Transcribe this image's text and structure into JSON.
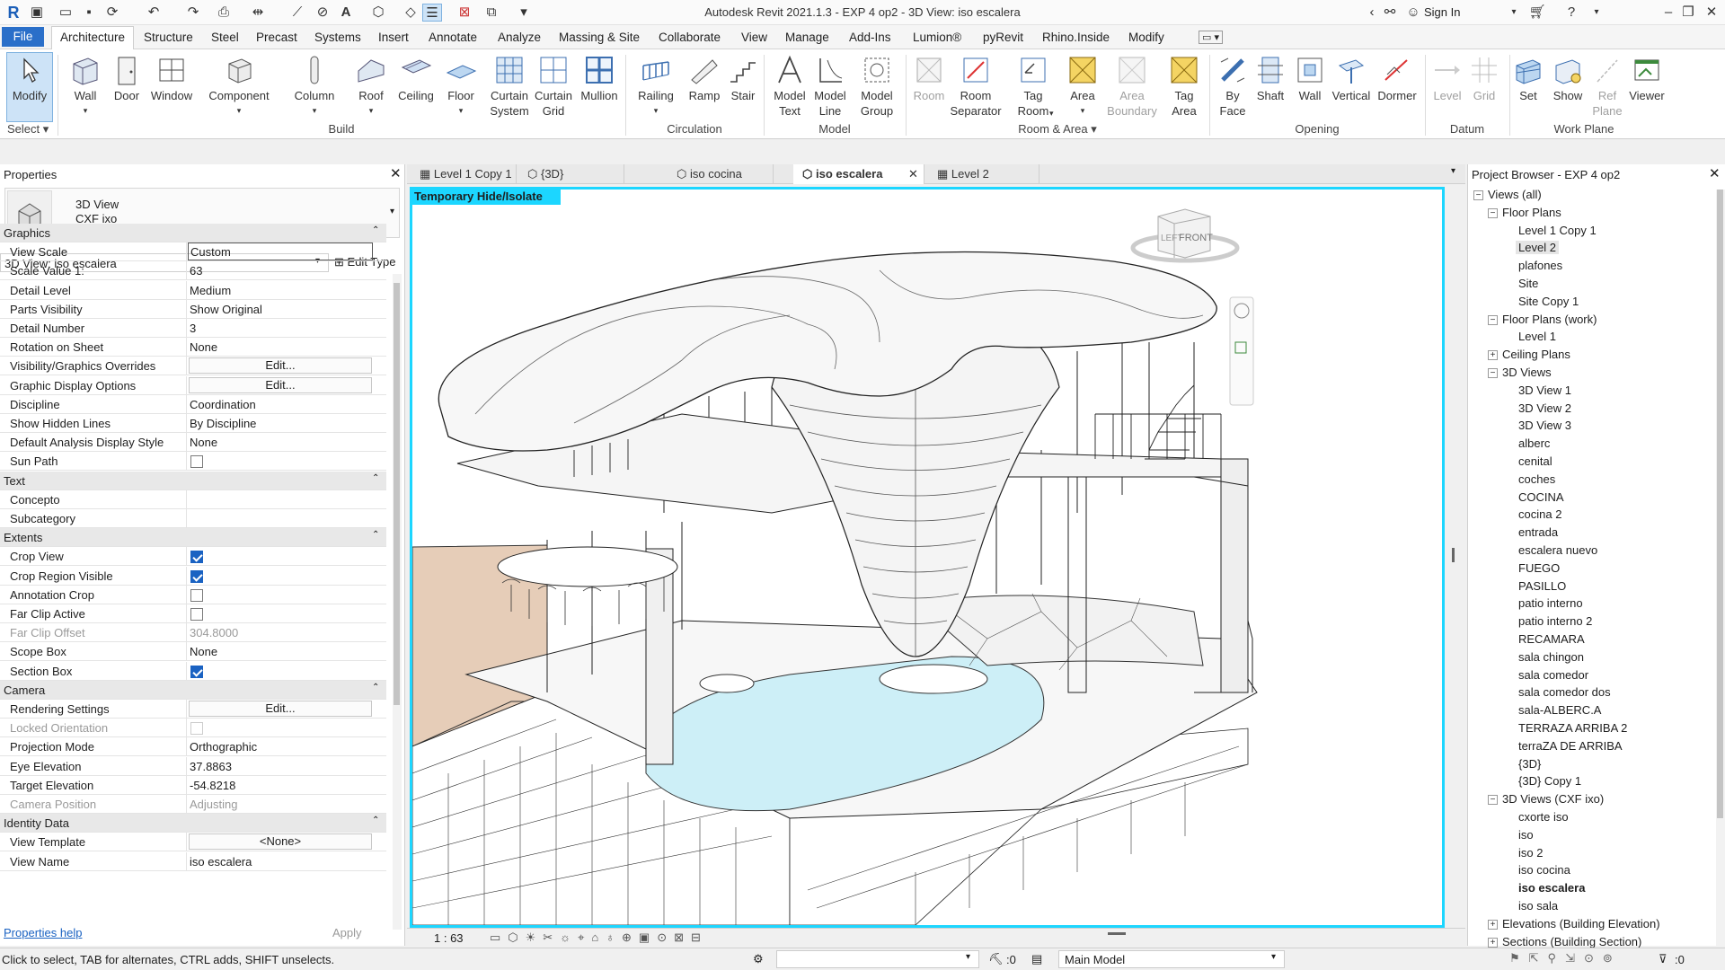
{
  "app": {
    "title": "Autodesk Revit 2021.1.3 - EXP 4 op2 - 3D View: iso escalera",
    "sign_in": "Sign In"
  },
  "menu": {
    "file": "File",
    "tabs": [
      "Architecture",
      "Structure",
      "Steel",
      "Precast",
      "Systems",
      "Insert",
      "Annotate",
      "Analyze",
      "Massing & Site",
      "Collaborate",
      "View",
      "Manage",
      "Add-Ins",
      "Lumion®",
      "pyRevit",
      "Rhino.Inside",
      "Modify"
    ]
  },
  "ribbon": {
    "modify": "Modify",
    "select": "Select",
    "build": {
      "label": "Build",
      "tools": [
        "Wall",
        "Door",
        "Window",
        "Component",
        "Column",
        "Roof",
        "Ceiling",
        "Floor",
        "Curtain\nSystem",
        "Curtain\nGrid",
        "Mullion"
      ]
    },
    "circulation": {
      "label": "Circulation",
      "tools": [
        "Railing",
        "Ramp",
        "Stair"
      ]
    },
    "model": {
      "label": "Model",
      "tools": [
        "Model\nText",
        "Model\nLine",
        "Model\nGroup"
      ]
    },
    "room_area": {
      "label": "Room & Area",
      "tools": [
        "Room",
        "Room\nSeparator",
        "Tag\nRoom",
        "Area",
        "Area\nBoundary",
        "Tag\nArea"
      ]
    },
    "opening": {
      "label": "Opening",
      "tools": [
        "By\nFace",
        "Shaft",
        "Wall",
        "Vertical",
        "Dormer"
      ]
    },
    "datum": {
      "label": "Datum",
      "tools": [
        "Level",
        "Grid"
      ]
    },
    "work_plane": {
      "label": "Work Plane",
      "tools": [
        "Set",
        "Show",
        "Ref\nPlane",
        "Viewer"
      ]
    }
  },
  "properties": {
    "title": "Properties",
    "type_line1": "3D View",
    "type_line2": "CXF ixo",
    "selector": "3D View: iso escalera",
    "edit_type": "Edit Type",
    "groups": {
      "graphics": "Graphics",
      "text": "Text",
      "extents": "Extents",
      "camera": "Camera",
      "identity": "Identity Data"
    },
    "rows": {
      "view_scale": [
        "View Scale",
        "Custom"
      ],
      "scale_value": [
        "Scale Value    1:",
        "63"
      ],
      "detail_level": [
        "Detail Level",
        "Medium"
      ],
      "parts_visibility": [
        "Parts Visibility",
        "Show Original"
      ],
      "detail_number": [
        "Detail Number",
        "3"
      ],
      "rotation": [
        "Rotation on Sheet",
        "None"
      ],
      "vg_overrides": [
        "Visibility/Graphics Overrides",
        "Edit..."
      ],
      "graphic_display": [
        "Graphic Display Options",
        "Edit..."
      ],
      "discipline": [
        "Discipline",
        "Coordination"
      ],
      "hidden_lines": [
        "Show Hidden Lines",
        "By Discipline"
      ],
      "analysis_style": [
        "Default Analysis Display Style",
        "None"
      ],
      "sun_path": [
        "Sun Path",
        ""
      ],
      "concepto": [
        "Concepto",
        ""
      ],
      "subcategory": [
        "Subcategory",
        ""
      ],
      "crop_view": [
        "Crop View",
        ""
      ],
      "crop_region": [
        "Crop Region Visible",
        ""
      ],
      "annotation_crop": [
        "Annotation Crop",
        ""
      ],
      "far_clip_active": [
        "Far Clip Active",
        ""
      ],
      "far_clip_offset": [
        "Far Clip Offset",
        "304.8000"
      ],
      "scope_box": [
        "Scope Box",
        "None"
      ],
      "section_box": [
        "Section Box",
        ""
      ],
      "rendering": [
        "Rendering Settings",
        "Edit..."
      ],
      "locked_orientation": [
        "Locked Orientation",
        ""
      ],
      "projection": [
        "Projection Mode",
        "Orthographic"
      ],
      "eye_elevation": [
        "Eye Elevation",
        "37.8863"
      ],
      "target_elevation": [
        "Target Elevation",
        "-54.8218"
      ],
      "camera_position": [
        "Camera Position",
        "Adjusting"
      ],
      "view_template": [
        "View Template",
        "<None>"
      ],
      "view_name": [
        "View Name",
        "iso escalera"
      ]
    },
    "help": "Properties help",
    "apply": "Apply"
  },
  "view_tabs": [
    "Level 1 Copy 1",
    "{3D}",
    "iso cocina",
    "iso escalera",
    "Level 2"
  ],
  "viewport": {
    "banner": "Temporary Hide/Isolate",
    "scale": "1 : 63",
    "cube_left": "LEFT",
    "cube_front": "FRONT"
  },
  "browser": {
    "title": "Project Browser - EXP 4 op2",
    "root": "Views (all)",
    "floor_plans": "Floor Plans",
    "floor_plans_items": [
      "Level 1 Copy 1",
      "Level 2",
      "plafones",
      "Site",
      "Site Copy 1"
    ],
    "floor_plans_work": "Floor Plans (work)",
    "floor_plans_work_items": [
      "Level 1"
    ],
    "ceiling_plans": "Ceiling Plans",
    "views_3d": "3D Views",
    "views_3d_items": [
      "3D View 1",
      "3D View 2",
      "3D View 3",
      "alberc",
      "cenital",
      "coches",
      "COCINA",
      "cocina 2",
      "entrada",
      "escalera nuevo",
      "FUEGO",
      "PASILLO",
      "patio interno",
      "patio interno 2",
      "RECAMARA",
      "sala chingon",
      "sala comedor",
      "sala comedor dos",
      "sala-ALBERC.A",
      "TERRAZA ARRIBA 2",
      "terraZA DE ARRIBA",
      "{3D}",
      "{3D} Copy 1"
    ],
    "views_3d_cxf": "3D Views (CXF ixo)",
    "views_3d_cxf_items": [
      "cxorte iso",
      "iso",
      "iso 2",
      "iso cocina",
      "iso escalera",
      "iso sala"
    ],
    "elevations": "Elevations (Building Elevation)",
    "sections": "Sections (Building Section)"
  },
  "status": {
    "hint": "Click to select, TAB for alternates, CTRL adds, SHIFT unselects.",
    "zero1": ":0",
    "workset": "Main Model",
    "zero2": ":0"
  }
}
